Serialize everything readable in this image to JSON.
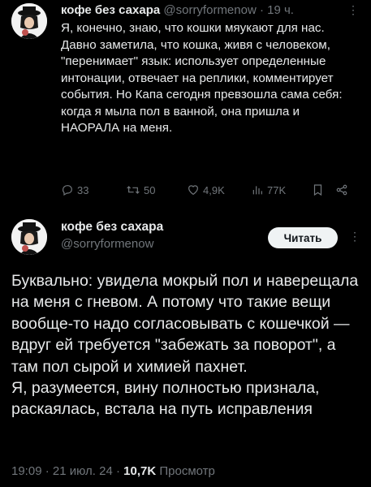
{
  "tweet1": {
    "author_name": "кофе без сахара",
    "handle": "@sorryformenow",
    "separator": "·",
    "time": "19 ч.",
    "more": "⋮",
    "text": "Я, конечно, знаю, что кошки мяукают для нас. Давно заметила, что кошка, живя с человеком, \"перенимает\" язык: использует определенные интонации, отвечает на реплики, комментирует события. Но Капа сегодня превзошла сама себя: когда я мыла пол в ванной, она пришла и НАОРАЛА на меня.",
    "actions": {
      "replies": "33",
      "retweets": "50",
      "likes": "4,9K",
      "views": "77K"
    }
  },
  "tweet2": {
    "author_name": "кофе без сахара",
    "handle": "@sorryformenow",
    "follow_label": "Читать",
    "more": "⋮",
    "text": "Буквально: увидела мокрый пол и наверещала на меня с гневом. А потому что такие вещи вообще-то надо согласовывать с кошечкой — вдруг ей требуется \"забежать за поворот\", а там пол сырой и химией пахнет.\nЯ, разумеется, вину полностью признала, раскаялась, встала на путь исправления",
    "time": "19:09",
    "date": "21 июл. 24",
    "views_count": "10,7K",
    "views_label": "Просмотр"
  },
  "colors": {
    "background": "#000000",
    "text": "#e7e9ea",
    "muted": "#71767b",
    "follow_bg": "#eff3f4"
  }
}
